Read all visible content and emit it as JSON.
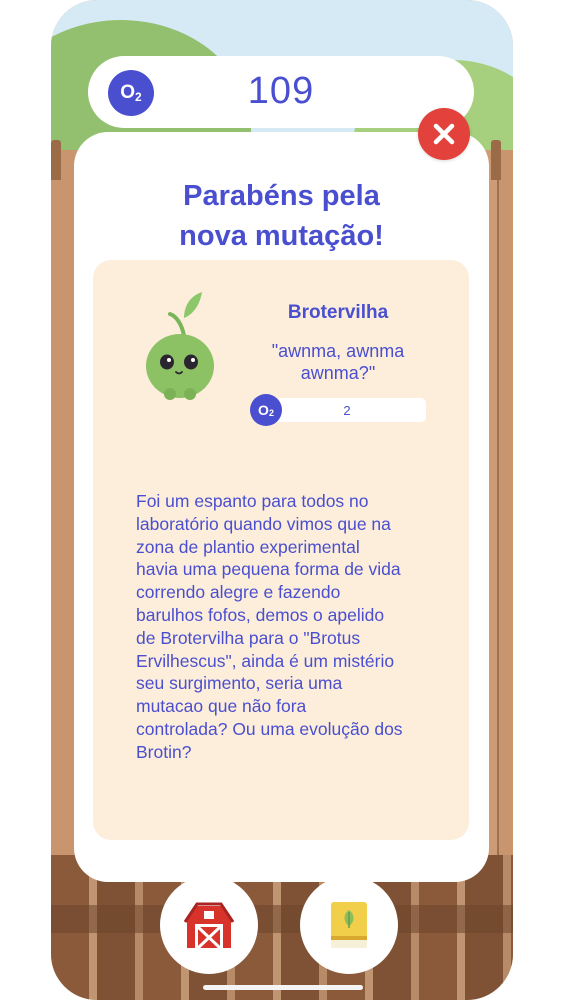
{
  "header": {
    "o2_label": "O",
    "o2_sub": "2",
    "o2_value": "109"
  },
  "modal": {
    "title_line1": "Parabéns pela",
    "title_line2": "nova mutação!",
    "close_icon": "close-x-icon"
  },
  "creature": {
    "name": "Brotervilha",
    "quote": "\"awnma, awnma awnma?\"",
    "o2_label": "O",
    "o2_sub": "2",
    "o2_value": "2"
  },
  "story": " Foi um espanto para todos no\nlaboratório quando vimos que na\nzona de plantio experimental\nhavia uma pequena forma de vida\ncorrendo alegre e fazendo\nbarulhos fofos, demos o apelido\nde Brotervilha para o \"Brotus\nErvilhescus\", ainda é um mistério\nseu surgimento, seria uma\nmutacao que não fora\ncontrolada? Ou uma evolução dos\nBrotin?",
  "nav": {
    "left_icon": "barn-icon",
    "right_icon": "book-icon"
  },
  "colors": {
    "accent": "#4a4fcf",
    "close": "#e2423b",
    "card": "#fdeedb"
  }
}
